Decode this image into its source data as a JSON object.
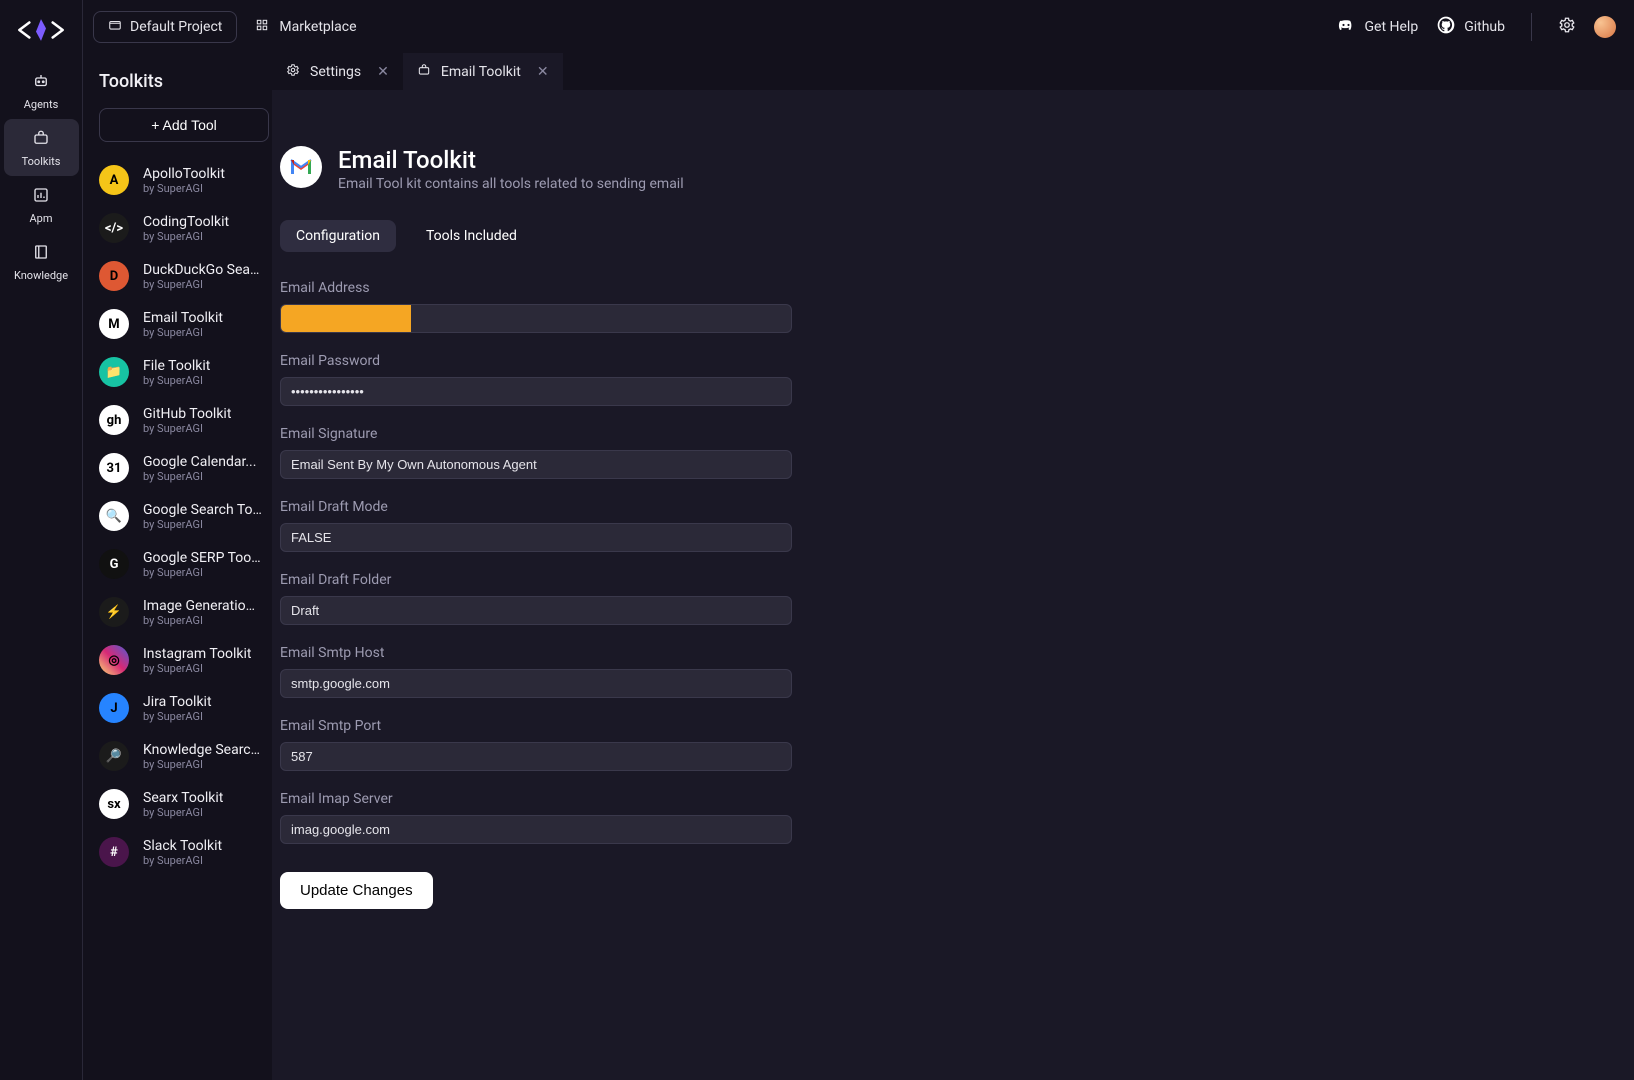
{
  "topbar": {
    "project_label": "Default Project",
    "marketplace_label": "Marketplace",
    "get_help_label": "Get Help",
    "github_label": "Github"
  },
  "rail": {
    "items": [
      {
        "label": "Agents"
      },
      {
        "label": "Toolkits"
      },
      {
        "label": "Apm"
      },
      {
        "label": "Knowledge"
      }
    ]
  },
  "sidebar": {
    "title": "Toolkits",
    "add_label": "+ Add Tool",
    "by_prefix": "by ",
    "items": [
      {
        "name": "ApolloToolkit",
        "by": "SuperAGI",
        "color": "#f5c518",
        "glyph": "A"
      },
      {
        "name": "CodingToolkit",
        "by": "SuperAGI",
        "color": "#1b1b1b",
        "glyph": "</>"
      },
      {
        "name": "DuckDuckGo Search...",
        "by": "SuperAGI",
        "color": "#de5833",
        "glyph": "D"
      },
      {
        "name": "Email Toolkit",
        "by": "SuperAGI",
        "color": "#ffffff",
        "glyph": "M"
      },
      {
        "name": "File Toolkit",
        "by": "SuperAGI",
        "color": "#17c3a3",
        "glyph": "📁"
      },
      {
        "name": "GitHub Toolkit",
        "by": "SuperAGI",
        "color": "#ffffff",
        "glyph": "gh"
      },
      {
        "name": "Google Calendar...",
        "by": "SuperAGI",
        "color": "#ffffff",
        "glyph": "31"
      },
      {
        "name": "Google Search Toolkit",
        "by": "SuperAGI",
        "color": "#ffffff",
        "glyph": "🔍"
      },
      {
        "name": "Google SERP Toolkit",
        "by": "SuperAGI",
        "color": "#111111",
        "glyph": "G"
      },
      {
        "name": "Image Generation...",
        "by": "SuperAGI",
        "color": "#1b1b1b",
        "glyph": "⚡"
      },
      {
        "name": "Instagram Toolkit",
        "by": "SuperAGI",
        "color": "linear-gradient(45deg,#feda75,#d62976,#4f5bd5)",
        "glyph": "◎"
      },
      {
        "name": "Jira Toolkit",
        "by": "SuperAGI",
        "color": "#2684ff",
        "glyph": "J"
      },
      {
        "name": "Knowledge Search...",
        "by": "SuperAGI",
        "color": "#1b1b1b",
        "glyph": "🔎"
      },
      {
        "name": "Searx Toolkit",
        "by": "SuperAGI",
        "color": "#ffffff",
        "glyph": "sx"
      },
      {
        "name": "Slack Toolkit",
        "by": "SuperAGI",
        "color": "#4a154b",
        "glyph": "#"
      }
    ]
  },
  "tabs": [
    {
      "label": "Settings",
      "icon": "gear",
      "active": false
    },
    {
      "label": "Email Toolkit",
      "icon": "toolkit",
      "active": true
    }
  ],
  "detail": {
    "title": "Email Toolkit",
    "description": "Email Tool kit contains all tools related to sending email",
    "subtabs": {
      "configuration": "Configuration",
      "tools_included": "Tools Included"
    },
    "fields": [
      {
        "label": "Email Address",
        "value": "",
        "type": "text",
        "redacted": true
      },
      {
        "label": "Email Password",
        "value": "................",
        "type": "password",
        "redacted": false
      },
      {
        "label": "Email Signature",
        "value": "Email Sent By My Own Autonomous Agent",
        "type": "text",
        "redacted": false
      },
      {
        "label": "Email Draft Mode",
        "value": "FALSE",
        "type": "text",
        "redacted": false
      },
      {
        "label": "Email Draft Folder",
        "value": "Draft",
        "type": "text",
        "redacted": false
      },
      {
        "label": "Email Smtp Host",
        "value": "smtp.google.com",
        "type": "text",
        "redacted": false
      },
      {
        "label": "Email Smtp Port",
        "value": "587",
        "type": "text",
        "redacted": false
      },
      {
        "label": "Email Imap Server",
        "value": "imag.google.com",
        "type": "text",
        "redacted": false
      }
    ],
    "submit_label": "Update Changes"
  }
}
